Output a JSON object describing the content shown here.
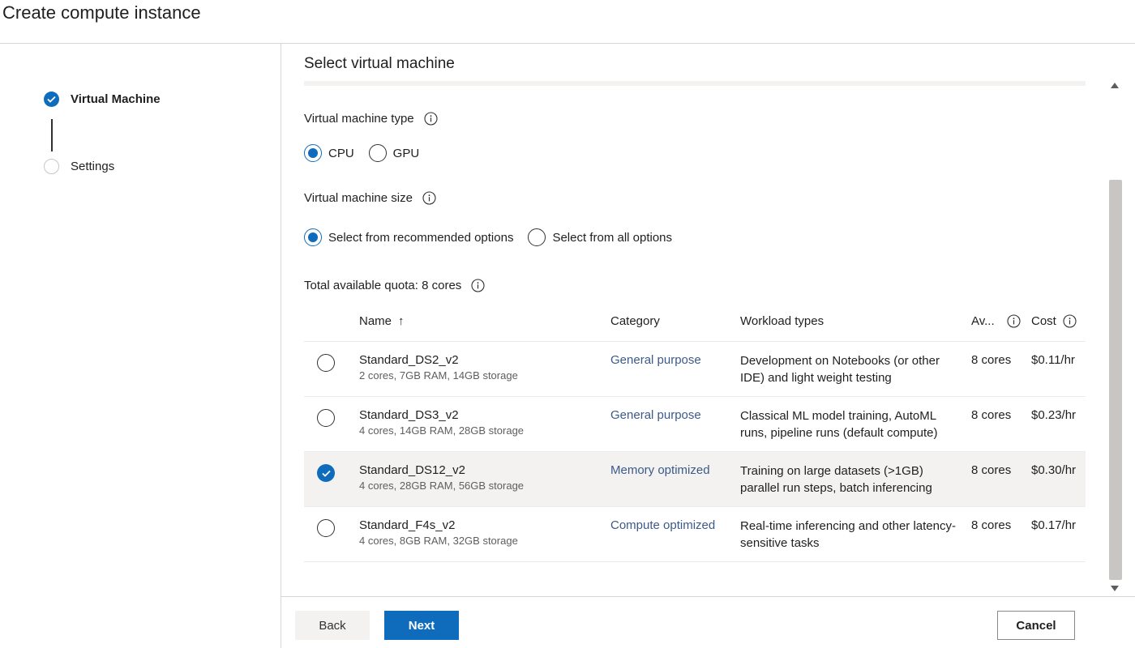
{
  "page": {
    "title": "Create compute instance"
  },
  "stepper": {
    "steps": [
      {
        "label": "Virtual Machine",
        "state": "done"
      },
      {
        "label": "Settings",
        "state": "pending"
      }
    ]
  },
  "main": {
    "title": "Select virtual machine",
    "vm_type": {
      "label": "Virtual machine type",
      "options": [
        "CPU",
        "GPU"
      ],
      "selected": "CPU"
    },
    "vm_size": {
      "label": "Virtual machine size",
      "options": [
        "Select from recommended options",
        "Select from all options"
      ],
      "selected": "Select from recommended options"
    },
    "quota": {
      "label": "Total available quota: 8 cores"
    },
    "table": {
      "columns": [
        "Name",
        "Category",
        "Workload types",
        "Av...",
        "Cost"
      ],
      "sort_indicator": "↑",
      "rows": [
        {
          "name": "Standard_DS2_v2",
          "spec": "2 cores, 7GB RAM, 14GB storage",
          "category": "General purpose",
          "workload": "Development on Notebooks (or other IDE) and light weight testing",
          "available": "8 cores",
          "cost": "$0.11/hr",
          "selected": false
        },
        {
          "name": "Standard_DS3_v2",
          "spec": "4 cores, 14GB RAM, 28GB storage",
          "category": "General purpose",
          "workload": "Classical ML model training, AutoML runs, pipeline runs (default compute)",
          "available": "8 cores",
          "cost": "$0.23/hr",
          "selected": false
        },
        {
          "name": "Standard_DS12_v2",
          "spec": "4 cores, 28GB RAM, 56GB storage",
          "category": "Memory optimized",
          "workload": "Training on large datasets (>1GB) parallel run steps, batch inferencing",
          "available": "8 cores",
          "cost": "$0.30/hr",
          "selected": true
        },
        {
          "name": "Standard_F4s_v2",
          "spec": "4 cores, 8GB RAM, 32GB storage",
          "category": "Compute optimized",
          "workload": "Real-time inferencing and other latency-sensitive tasks",
          "available": "8 cores",
          "cost": "$0.17/hr",
          "selected": false
        }
      ]
    }
  },
  "footer": {
    "back": "Back",
    "next": "Next",
    "cancel": "Cancel"
  },
  "colors": {
    "accent": "#0f6cbd",
    "category_link": "#3b5a8a",
    "selected_row": "#f3f2f1"
  }
}
